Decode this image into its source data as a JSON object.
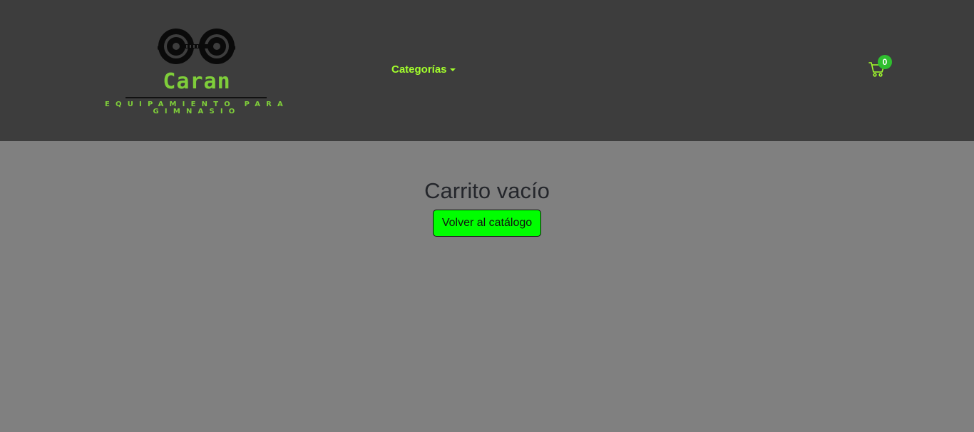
{
  "brand": {
    "name": "Caran",
    "tagline": "Equipamiento para gimnasio",
    "logo_icon": "dumbbell-weights-icon",
    "accent_color": "#7fce3a"
  },
  "nav": {
    "categories_label": "Categorías",
    "categories_color": "#a3ff2c"
  },
  "cart": {
    "icon": "cart-icon",
    "count": "0",
    "badge_color": "#2fbf2f"
  },
  "main": {
    "title": "Carrito vacío",
    "back_button_label": "Volver al catálogo",
    "back_button_color": "#00ff00"
  }
}
